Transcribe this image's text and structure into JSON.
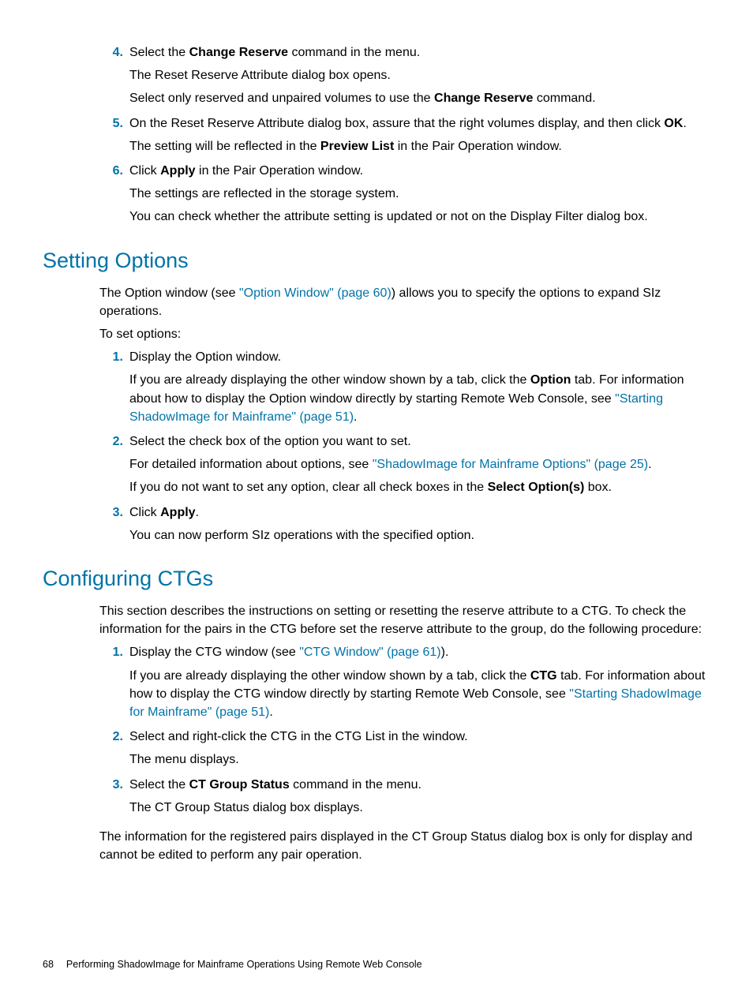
{
  "item4": {
    "num": "4.",
    "p1a": "Select the ",
    "p1b": "Change Reserve",
    "p1c": " command in the menu.",
    "p2": "The Reset Reserve Attribute dialog box opens.",
    "p3a": "Select only reserved and unpaired volumes to use the ",
    "p3b": "Change Reserve",
    "p3c": " command."
  },
  "item5": {
    "num": "5.",
    "p1a": "On the Reset Reserve Attribute dialog box, assure that the right volumes display, and then click ",
    "p1b": "OK",
    "p1c": ".",
    "p2a": "The setting will be reflected in the ",
    "p2b": "Preview List",
    "p2c": " in the Pair Operation window."
  },
  "item6": {
    "num": "6.",
    "p1a": "Click ",
    "p1b": "Apply",
    "p1c": " in the Pair Operation window.",
    "p2": "The settings are reflected in the storage system.",
    "p3": "You can check whether the attribute setting is updated or not on the Display Filter dialog box."
  },
  "h1": "Setting Options",
  "so_intro_a": "The Option window (see ",
  "so_intro_link": "\"Option Window\" (page 60)",
  "so_intro_b": ") allows you to specify the options to expand SIz operations.",
  "so_toset": "To set options:",
  "so1": {
    "num": "1.",
    "p1": "Display the Option window.",
    "p2a": "If you are already displaying the other window shown by a tab, click the ",
    "p2b": "Option",
    "p2c": " tab. For information about how to display the Option window directly by starting Remote Web Console, see ",
    "p2link": "\"Starting ShadowImage for Mainframe\" (page 51)",
    "p2d": "."
  },
  "so2": {
    "num": "2.",
    "p1": "Select the check box of the option you want to set.",
    "p2a": "For detailed information about options, see ",
    "p2link": "\"ShadowImage for Mainframe Options\" (page 25)",
    "p2b": ".",
    "p3a": "If you do not want to set any option, clear all check boxes in the ",
    "p3b": "Select Option(s)",
    "p3c": " box."
  },
  "so3": {
    "num": "3.",
    "p1a": "Click ",
    "p1b": "Apply",
    "p1c": ".",
    "p2": "You can now perform SIz operations with the specified option."
  },
  "h2": "Configuring CTGs",
  "ctg_intro": "This section describes the instructions on setting or resetting the reserve attribute to a CTG. To check the information for the pairs in the CTG before set the reserve attribute to the group, do the following procedure:",
  "ctg1": {
    "num": "1.",
    "p1a": "Display the CTG window (see ",
    "p1link": "\"CTG Window\" (page 61)",
    "p1b": ").",
    "p2a": "If you are already displaying the other window shown by a tab, click the ",
    "p2b": "CTG",
    "p2c": " tab. For information about how to display the CTG window directly by starting Remote Web Console, see ",
    "p2link": "\"Starting ShadowImage for Mainframe\" (page 51)",
    "p2d": "."
  },
  "ctg2": {
    "num": "2.",
    "p1": "Select and right-click the CTG in the CTG List in the window.",
    "p2": "The menu displays."
  },
  "ctg3": {
    "num": "3.",
    "p1a": "Select the ",
    "p1b": "CT Group Status",
    "p1c": " command in the menu.",
    "p2": "The CT Group Status dialog box displays."
  },
  "ctg_outro": "The information for the registered pairs displayed in the CT Group Status dialog box is only for display and cannot be edited to perform any pair operation.",
  "footer_num": "68",
  "footer_text": "Performing ShadowImage for Mainframe Operations Using Remote Web Console"
}
